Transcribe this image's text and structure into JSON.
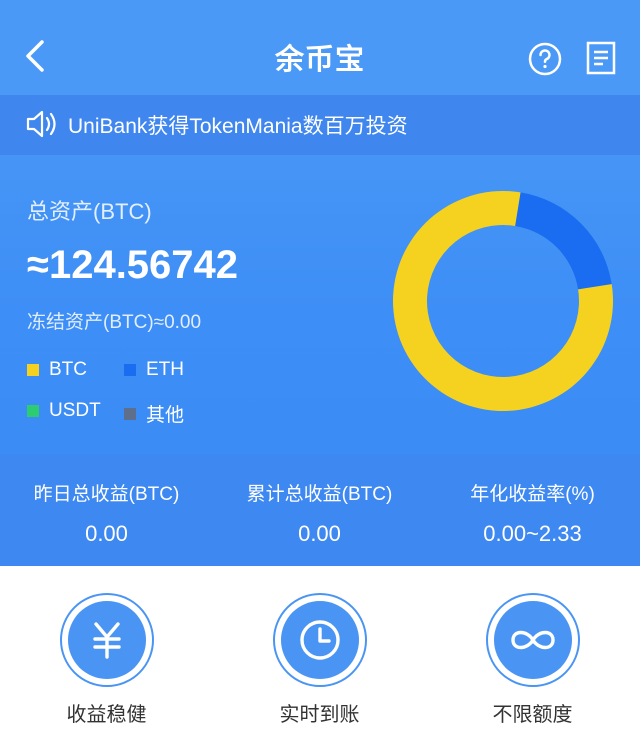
{
  "header": {
    "title": "余币宝",
    "back_icon": "chevron-left-icon",
    "help_icon": "question-circle-icon",
    "doc_icon": "document-list-icon"
  },
  "notice": {
    "icon": "speaker-icon",
    "text": "UniBank获得TokenMania数百万投资"
  },
  "assets": {
    "label": "总资产(BTC)",
    "value": "≈124.56742",
    "frozen": "冻结资产(BTC)≈0.00"
  },
  "legend": [
    {
      "label": "BTC",
      "color": "#f5d21f"
    },
    {
      "label": "ETH",
      "color": "#1a6cf0"
    },
    {
      "label": "USDT",
      "color": "#2ecc71"
    },
    {
      "label": "其他",
      "color": "#5d6f8a"
    }
  ],
  "chart_data": {
    "type": "pie",
    "categories": [
      "BTC",
      "ETH",
      "USDT",
      "其他"
    ],
    "values": [
      80,
      20,
      0,
      0
    ],
    "colors": [
      "#f5d21f",
      "#1a6cf0",
      "#2ecc71",
      "#5d6f8a"
    ]
  },
  "stats": [
    {
      "label": "昨日总收益(BTC)",
      "value": "0.00"
    },
    {
      "label": "累计总收益(BTC)",
      "value": "0.00"
    },
    {
      "label": "年化收益率(%)",
      "value": "0.00~2.33"
    }
  ],
  "features": [
    {
      "label": "收益稳健",
      "icon": "yuan-icon"
    },
    {
      "label": "实时到账",
      "icon": "clock-icon"
    },
    {
      "label": "不限额度",
      "icon": "infinity-icon"
    }
  ],
  "colors": {
    "primary": "#4a95f4",
    "notice_bg": "#3f86ee",
    "stats_bg": "#3e88f2"
  }
}
